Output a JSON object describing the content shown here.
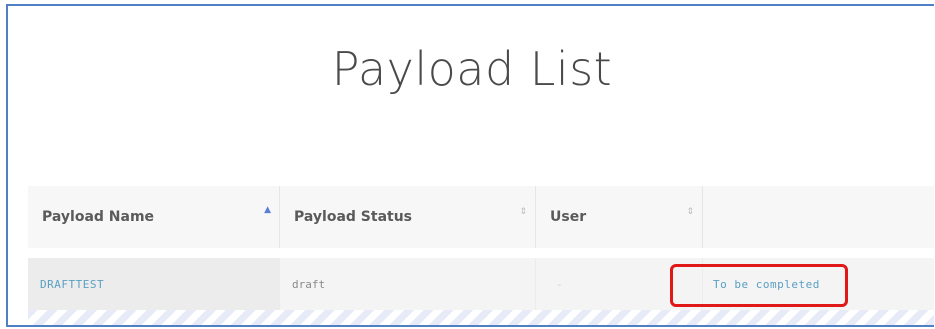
{
  "page": {
    "title": "Payload List"
  },
  "table": {
    "columns": [
      {
        "label": "Payload Name",
        "sort": "asc"
      },
      {
        "label": "Payload Status",
        "sort": "none"
      },
      {
        "label": "User",
        "sort": "none"
      },
      {
        "label": "",
        "sort": "none"
      }
    ],
    "rows": [
      {
        "payload_name": "DRAFTTEST",
        "payload_status": "draft",
        "user": "-",
        "action": "To be completed"
      }
    ]
  },
  "colors": {
    "frame_border": "#4f7fc4",
    "link": "#5aa0c2",
    "highlight": "#e01818",
    "sort_active": "#5b7fd8"
  },
  "icons": {
    "sort_active": "sort-asc-icon",
    "sort_inactive": "sort-both-icon"
  }
}
